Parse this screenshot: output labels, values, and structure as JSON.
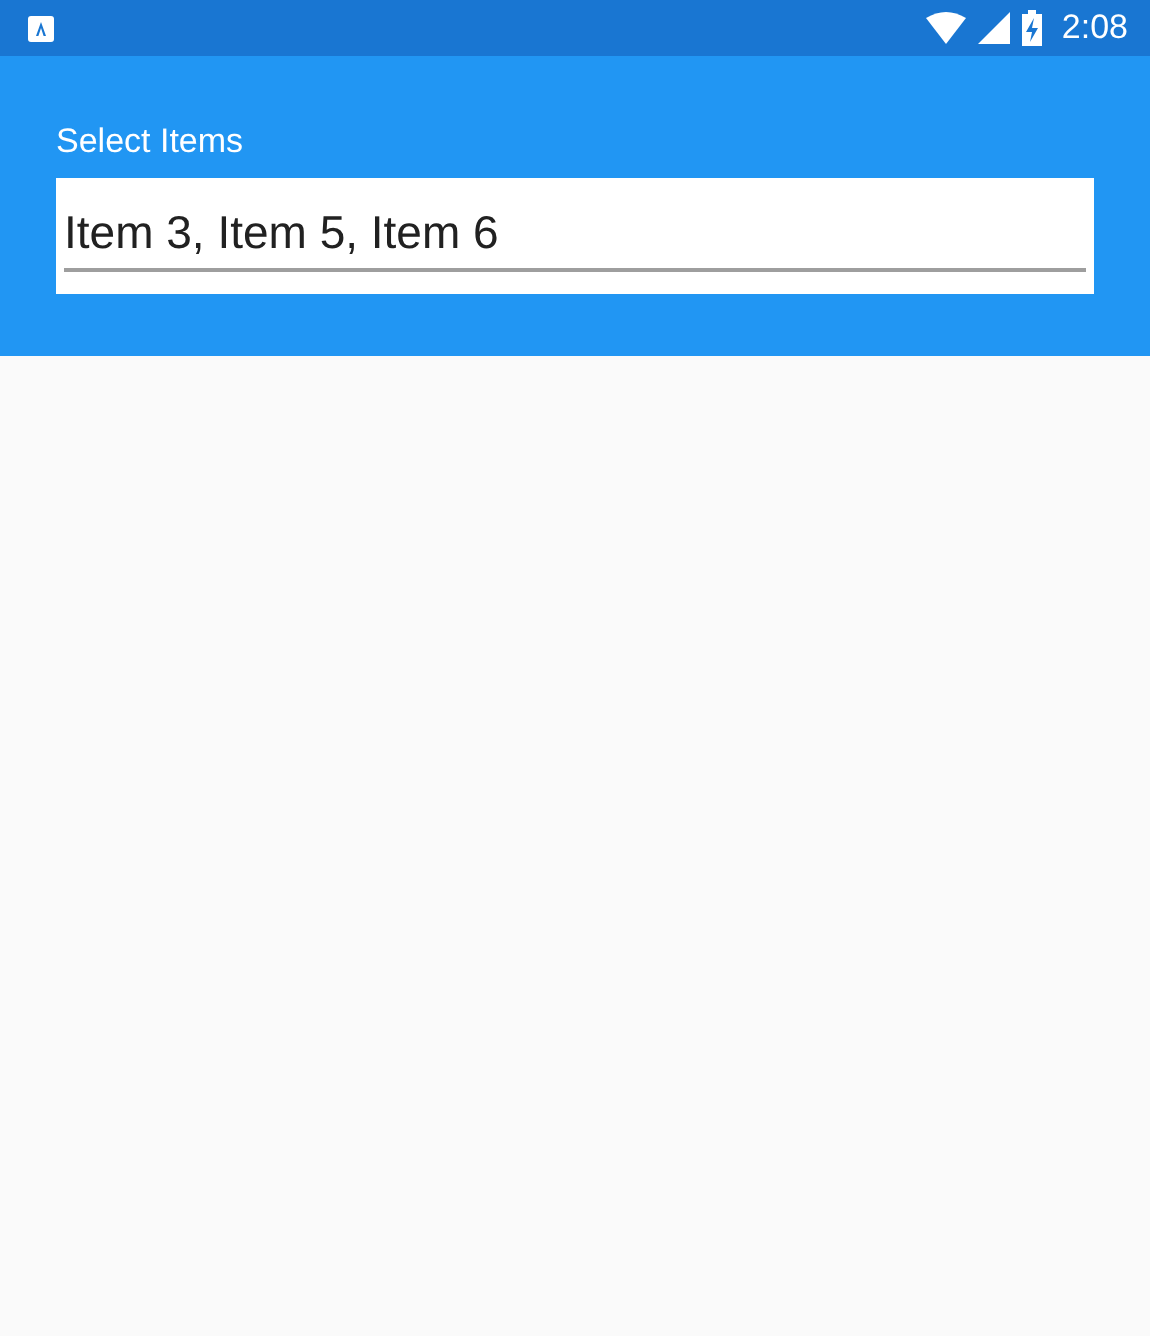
{
  "status_bar": {
    "time": "2:08"
  },
  "header": {
    "label": "Select Items",
    "field": {
      "value": "Item 3, Item 5, Item 6"
    }
  }
}
